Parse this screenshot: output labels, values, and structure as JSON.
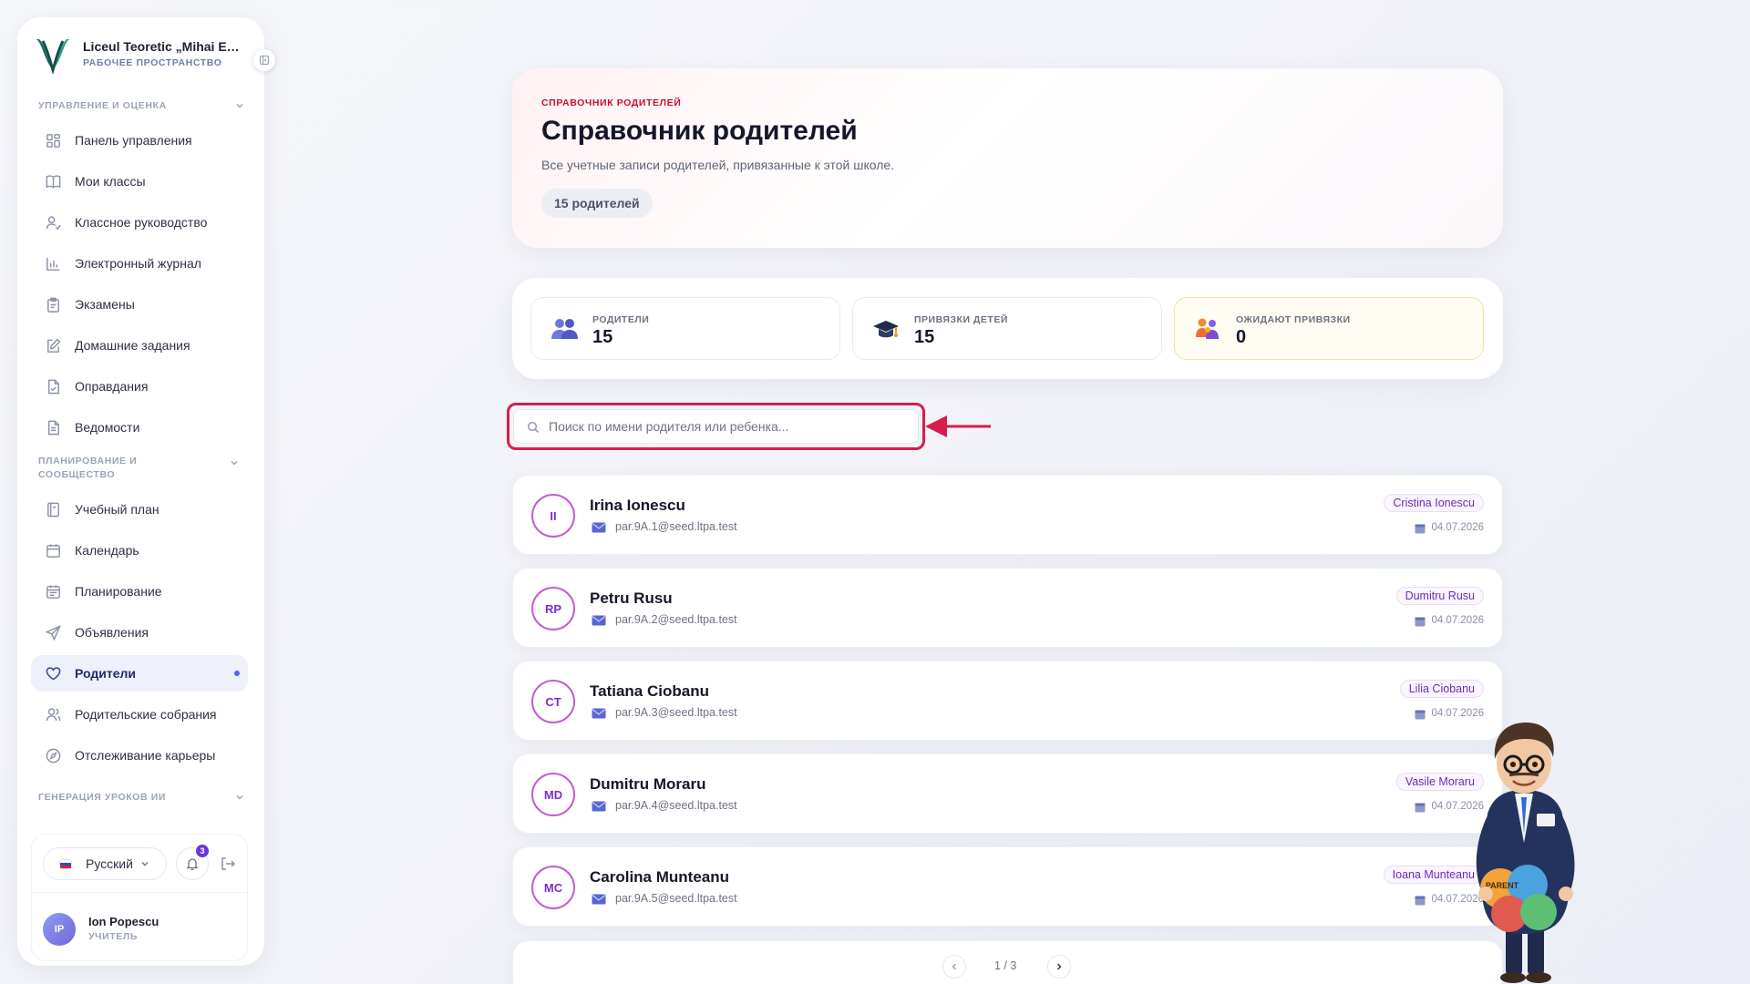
{
  "brand": {
    "name": "Liceul Teoretic „Mihai Eminescu”",
    "subtitle": "РАБОЧЕЕ ПРОСТРАНСТВО"
  },
  "sidebar": {
    "sections": [
      {
        "title": "УПРАВЛЕНИЕ И ОЦЕНКА"
      },
      {
        "title": "ПЛАНИРОВАНИЕ И СООБЩЕСТВО"
      },
      {
        "title": "ГЕНЕРАЦИЯ УРОКОВ ИИ"
      }
    ],
    "items": [
      {
        "label": "Панель управления",
        "icon": "dashboard-icon"
      },
      {
        "label": "Мои классы",
        "icon": "book-icon"
      },
      {
        "label": "Классное руководство",
        "icon": "user-check-icon"
      },
      {
        "label": "Электронный журнал",
        "icon": "bar-chart-icon"
      },
      {
        "label": "Экзамены",
        "icon": "clipboard-icon"
      },
      {
        "label": "Домашние задания",
        "icon": "edit-icon"
      },
      {
        "label": "Оправдания",
        "icon": "file-check-icon"
      },
      {
        "label": "Ведомости",
        "icon": "file-text-icon"
      },
      {
        "label": "Учебный план",
        "icon": "notebook-icon"
      },
      {
        "label": "Календарь",
        "icon": "calendar-icon"
      },
      {
        "label": "Планирование",
        "icon": "calendar-list-icon"
      },
      {
        "label": "Объявления",
        "icon": "send-icon"
      },
      {
        "label": "Родители",
        "icon": "heart-icon",
        "active": true
      },
      {
        "label": "Родительские собрания",
        "icon": "users-icon"
      },
      {
        "label": "Отслеживание карьеры",
        "icon": "compass-icon"
      }
    ],
    "language": "Русский",
    "notifications_count": "3",
    "user": {
      "initials": "IP",
      "name": "Ion Popescu",
      "role": "УЧИТЕЛЬ"
    }
  },
  "hero": {
    "kicker": "СПРАВОЧНИК РОДИТЕЛЕЙ",
    "title": "Справочник родителей",
    "subtitle": "Все учетные записи родителей, привязанные к этой школе.",
    "count_pill": "15 родителей"
  },
  "stats": [
    {
      "label": "РОДИТЕЛИ",
      "value": "15",
      "icon": "parents-icon"
    },
    {
      "label": "ПРИВЯЗКИ ДЕТЕЙ",
      "value": "15",
      "icon": "graduation-cap-icon"
    },
    {
      "label": "ОЖИДАЮТ ПРИВЯЗКИ",
      "value": "0",
      "icon": "family-icon"
    }
  ],
  "search": {
    "placeholder": "Поиск по имени родителя или ребенка..."
  },
  "parents": [
    {
      "initials": "II",
      "name": "Irina Ionescu",
      "email": "par.9A.1@seed.ltpa.test",
      "child": "Cristina Ionescu",
      "date": "04.07.2026"
    },
    {
      "initials": "RP",
      "name": "Petru Rusu",
      "email": "par.9A.2@seed.ltpa.test",
      "child": "Dumitru Rusu",
      "date": "04.07.2026"
    },
    {
      "initials": "CT",
      "name": "Tatiana Ciobanu",
      "email": "par.9A.3@seed.ltpa.test",
      "child": "Lilia Ciobanu",
      "date": "04.07.2026"
    },
    {
      "initials": "MD",
      "name": "Dumitru Moraru",
      "email": "par.9A.4@seed.ltpa.test",
      "child": "Vasile Moraru",
      "date": "04.07.2026"
    },
    {
      "initials": "MC",
      "name": "Carolina Munteanu",
      "email": "par.9A.5@seed.ltpa.test",
      "child": "Ioana Munteanu",
      "date": "04.07.2026"
    }
  ],
  "pagination": {
    "text": "1 / 3"
  },
  "colors": {
    "accent": "#5463e8",
    "highlight": "#d61e4a",
    "avatar_ring": "#c55bd4"
  }
}
